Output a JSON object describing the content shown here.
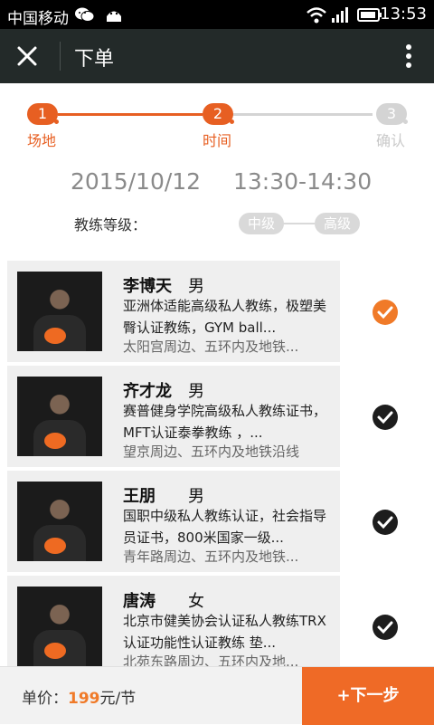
{
  "status": {
    "carrier": "中国移动",
    "time": "13:53",
    "icons": [
      "wechat-icon",
      "android-icon",
      "wifi-icon",
      "signal-icon",
      "battery-icon"
    ]
  },
  "appbar": {
    "title": "下单",
    "close_icon": "close-icon",
    "more_icon": "more-icon"
  },
  "steps": [
    {
      "number": "1",
      "label": "场地",
      "state": "done"
    },
    {
      "number": "2",
      "label": "时间",
      "state": "active"
    },
    {
      "number": "3",
      "label": "确认",
      "state": "pending"
    }
  ],
  "booking": {
    "date": "2015/10/12",
    "time_range": "13:30-14:30",
    "level_label": "教练等级：",
    "levels": [
      "中级",
      "高级"
    ]
  },
  "coaches": [
    {
      "name": "李博天",
      "gender": "男",
      "description": "亚洲体适能高级私人教练，极塑美臀认证教练，GYM ball...",
      "location": "太阳宫周边、五环内及地铁...",
      "selected": true
    },
    {
      "name": "齐才龙",
      "gender": "男",
      "description": "赛普健身学院高级私人教练证书， MFT认证泰拳教练 ，...",
      "location": "望京周边、五环内及地铁沿线",
      "selected": false
    },
    {
      "name": "王朋",
      "gender": "男",
      "description": "国职中级私人教练认证，社会指导员证书，800米国家一级...",
      "location": "青年路周边、五环内及地铁...",
      "selected": false
    },
    {
      "name": "唐涛",
      "gender": "女",
      "description": "北京市健美协会认证私人教练TRX认证功能性认证教练 垫...",
      "location": "北苑东路周边、五环内及地...",
      "selected": false
    }
  ],
  "footer": {
    "price_label": "单价：",
    "price_value": "199",
    "price_unit": "元/节",
    "next_button": "+下一步"
  },
  "colors": {
    "accent": "#ef6a26",
    "done_step": "#e75f22",
    "pending": "#d4d4d4",
    "selected_check": "#f07a28",
    "unselected_check": "#1d1d1d"
  }
}
